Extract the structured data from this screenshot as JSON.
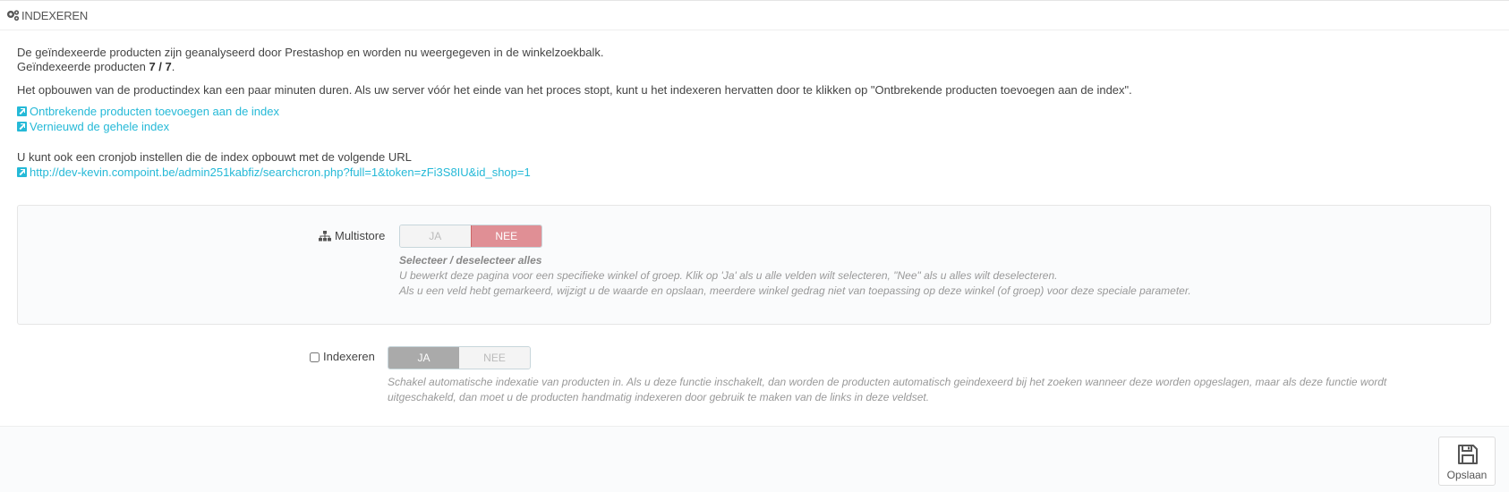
{
  "panel": {
    "title": "INDEXEREN",
    "title_icon": "cogs-icon"
  },
  "intro": {
    "line1": "De geïndexeerde producten zijn geanalyseerd door Prestashop en worden nu weergegeven in de winkelzoekbalk.",
    "indexed_prefix": "Geïndexeerde producten",
    "indexed_count": "7 / 7",
    "indexed_suffix": ".",
    "rebuild_note": "Het opbouwen van de productindex kan een paar minuten duren. Als uw server vóór het einde van het proces stopt, kunt u het indexeren hervatten door te klikken op \"Ontbrekende producten toevoegen aan de index\"."
  },
  "links": {
    "add_missing": "Ontbrekende producten toevoegen aan de index",
    "rebuild_all": "Vernieuwd de gehele index",
    "link_icon": "external-link-icon"
  },
  "cron": {
    "note": "U kunt ook een cronjob instellen die de index opbouwt met de volgende URL",
    "url": "http://dev-kevin.compoint.be/admin251kabfiz/searchcron.php?full=1&token=zFi3S8IU&id_shop=1"
  },
  "multistore": {
    "label": "Multistore",
    "icon": "sitemap-icon",
    "yes": "JA",
    "no": "NEE",
    "selected": "NEE",
    "help_title": "Selecteer / deselecteer alles",
    "help_line1": "U bewerkt deze pagina voor een specifieke winkel of groep. Klik op 'Ja' als u alle velden wilt selecteren, \"Nee\" als u alles wilt deselecteren.",
    "help_line2": "Als u een veld hebt gemarkeerd, wijzigt u de waarde en opslaan, meerdere winkel gedrag niet van toepassing op deze winkel (of groep) voor deze speciale parameter."
  },
  "indexeren": {
    "label": "Indexeren",
    "checked": false,
    "yes": "JA",
    "no": "NEE",
    "selected": "JA",
    "help_line1": "Schakel automatische indexatie van producten in. Als u deze functie inschakelt, dan worden de producten automatisch geindexeerd bij het zoeken wanneer deze worden opgeslagen, maar als deze functie wordt",
    "help_line2": "uitgeschakeld, dan moet u de producten handmatig indexeren door gebruik te maken van de links in deze veldset."
  },
  "footer": {
    "save_label": "Opslaan",
    "save_icon": "floppy-disk-icon"
  },
  "colors": {
    "link": "#25b9d7",
    "switch_no_active": "#e08f95",
    "switch_yes_active": "#aaaaaa"
  }
}
